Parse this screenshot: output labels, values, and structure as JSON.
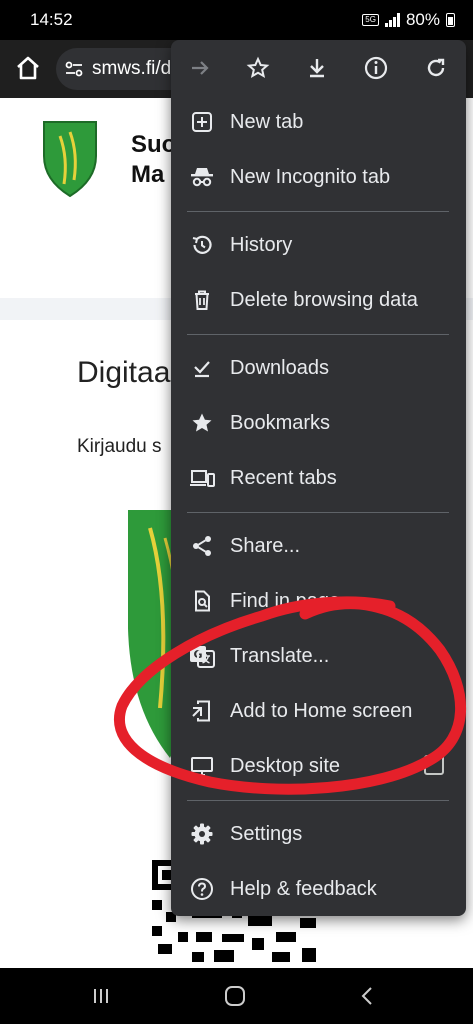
{
  "status_bar": {
    "time": "14:52",
    "network": "5G",
    "battery": "80%"
  },
  "toolbar": {
    "url": "smws.fi/d"
  },
  "page": {
    "site_name_lines": [
      "Suo",
      "Ma"
    ],
    "heading": "Digitaa",
    "text": "Kirjaudu s"
  },
  "menu": {
    "top_actions": [
      "forward-icon",
      "star-icon",
      "download-icon",
      "info-icon",
      "refresh-icon"
    ],
    "items": [
      {
        "label": "New tab",
        "icon": "new-tab-icon"
      },
      {
        "label": "New Incognito tab",
        "icon": "incognito-icon"
      },
      {
        "label": "History",
        "icon": "history-icon"
      },
      {
        "label": "Delete browsing data",
        "icon": "trash-icon"
      },
      {
        "label": "Downloads",
        "icon": "downloads-icon"
      },
      {
        "label": "Bookmarks",
        "icon": "bookmarks-icon"
      },
      {
        "label": "Recent tabs",
        "icon": "recent-tabs-icon"
      },
      {
        "label": "Share...",
        "icon": "share-icon"
      },
      {
        "label": "Find in page",
        "icon": "find-in-page-icon"
      },
      {
        "label": "Translate...",
        "icon": "translate-icon"
      },
      {
        "label": "Add to Home screen",
        "icon": "add-to-home-icon"
      },
      {
        "label": "Desktop site",
        "icon": "desktop-icon"
      },
      {
        "label": "Settings",
        "icon": "settings-icon"
      },
      {
        "label": "Help & feedback",
        "icon": "help-icon"
      }
    ]
  },
  "colors": {
    "menu_bg": "#303134",
    "annotation": "#e5202a",
    "logo_green": "#2e9a3a",
    "logo_yellow": "#e6d13a"
  }
}
